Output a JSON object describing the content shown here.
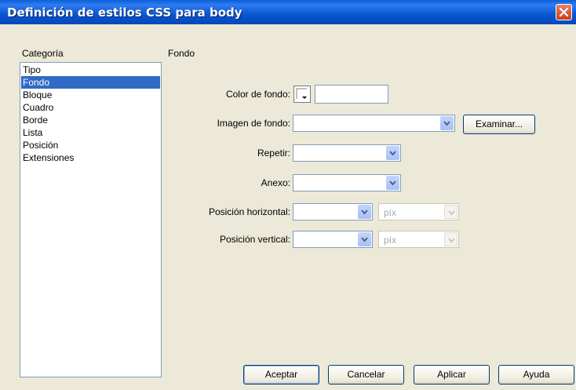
{
  "window": {
    "title": "Definición de estilos CSS para body"
  },
  "category": {
    "header": "Categoría",
    "items": [
      {
        "label": "Tipo",
        "selected": false
      },
      {
        "label": "Fondo",
        "selected": true
      },
      {
        "label": "Bloque",
        "selected": false
      },
      {
        "label": "Cuadro",
        "selected": false
      },
      {
        "label": "Borde",
        "selected": false
      },
      {
        "label": "Lista",
        "selected": false
      },
      {
        "label": "Posición",
        "selected": false
      },
      {
        "label": "Extensiones",
        "selected": false
      }
    ]
  },
  "panel": {
    "header": "Fondo",
    "color_label": "Color de fondo:",
    "color_value": "",
    "image_label": "Imagen de fondo:",
    "image_value": "",
    "browse_label": "Examinar...",
    "repeat_label": "Repetir:",
    "attach_label": "Anexo:",
    "hpos_label": "Posición horizontal:",
    "hpos_unit": "píx",
    "vpos_label": "Posición vertical:",
    "vpos_unit": "píx"
  },
  "buttons": {
    "ok": "Aceptar",
    "cancel": "Cancelar",
    "apply": "Aplicar",
    "help": "Ayuda"
  },
  "colors": {
    "title_bar": "#0a5fd8",
    "selection": "#316ac5",
    "dialog_bg": "#ece9d8"
  }
}
